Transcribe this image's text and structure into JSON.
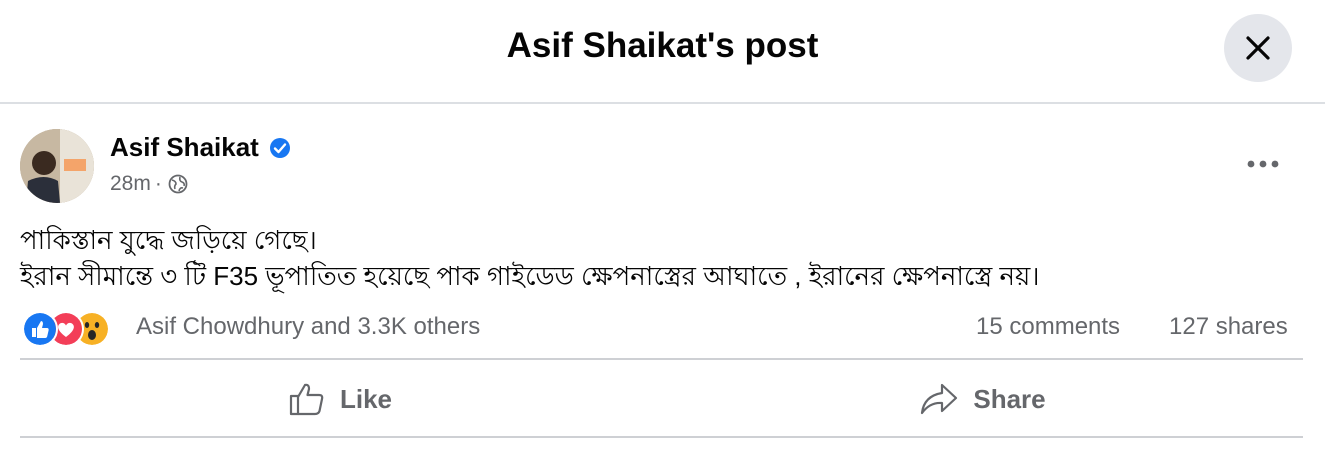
{
  "header": {
    "title": "Asif Shaikat's post"
  },
  "icons": {
    "close": "close-icon",
    "verified": "verified-badge-icon",
    "privacy": "globe-icon",
    "more": "more-dots-icon",
    "like": "thumbs-up-icon",
    "share": "share-arrow-icon"
  },
  "post": {
    "author": "Asif Shaikat",
    "time": "28m",
    "separator": "·",
    "lines": [
      "পাকিস্তান যুদ্ধে জড়িয়ে গেছে।",
      "ইরান সীমান্তে ৩ টি F35 ভূপাতিত হয়েছে পাক গাইডেড ক্ষেপনাস্ত্রের আঘাতে , ইরানের ক্ষেপনাস্ত্রে নয়।"
    ]
  },
  "stats": {
    "reactions": [
      "like",
      "love",
      "wow"
    ],
    "reaction_summary": "Asif Chowdhury and 3.3K others",
    "comments": "15 comments",
    "shares": "127 shares"
  },
  "actions": {
    "like_label": "Like",
    "share_label": "Share"
  },
  "colors": {
    "like_blue": "#1877f2",
    "love_red": "#f33e58",
    "wow_yellow": "#f7b125",
    "secondary_text": "#65676b"
  }
}
